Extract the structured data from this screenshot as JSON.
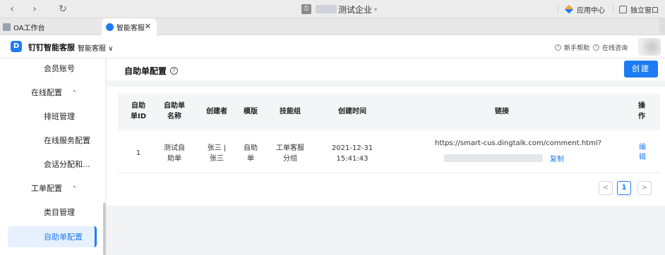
{
  "window": {
    "org_name": "测试企业",
    "app_center": "应用中心",
    "independent_window": "独立窗口"
  },
  "tabs": [
    {
      "label": "OA工作台"
    },
    {
      "label": "智能客服"
    }
  ],
  "app": {
    "name": "钉钉智能客服",
    "subtitle": "智能客服 ∨",
    "help": "新手帮助",
    "consult": "在线咨询"
  },
  "sidebar": {
    "items": [
      {
        "label": "会员账号",
        "kind": "sub"
      },
      {
        "label": "在线配置",
        "kind": "group",
        "caret": "⌃"
      },
      {
        "label": "排班管理",
        "kind": "sub"
      },
      {
        "label": "在线服务配置",
        "kind": "sub"
      },
      {
        "label": "会话分配和...",
        "kind": "sub"
      },
      {
        "label": "工单配置",
        "kind": "group",
        "caret": "⌃"
      },
      {
        "label": "类目管理",
        "kind": "sub"
      },
      {
        "label": "自助单配置",
        "kind": "sub",
        "active": true
      }
    ]
  },
  "page": {
    "title": "自助单配置",
    "create_label": "创建"
  },
  "table": {
    "headers": {
      "id": "自助\n单ID",
      "name": "自助单\n名称",
      "creator": "创建者",
      "template": "模版",
      "skill": "技能组",
      "time": "创建时间",
      "link": "链接",
      "op": "操\n作"
    },
    "rows": [
      {
        "id": "1",
        "name": "测试自\n助单",
        "creator": "张三 |\n张三",
        "template": "自助\n单",
        "skill": "工单客服\n分组",
        "time": "2021-12-31\n15:41:43",
        "link": "https://smart-cus.dingtalk.com/comment.html?",
        "copy": "复制",
        "edit": "编\n辑"
      }
    ]
  },
  "pagination": {
    "prev": "<",
    "current": "1",
    "next": ">"
  },
  "colors": {
    "accent": "#1e7cf2"
  }
}
